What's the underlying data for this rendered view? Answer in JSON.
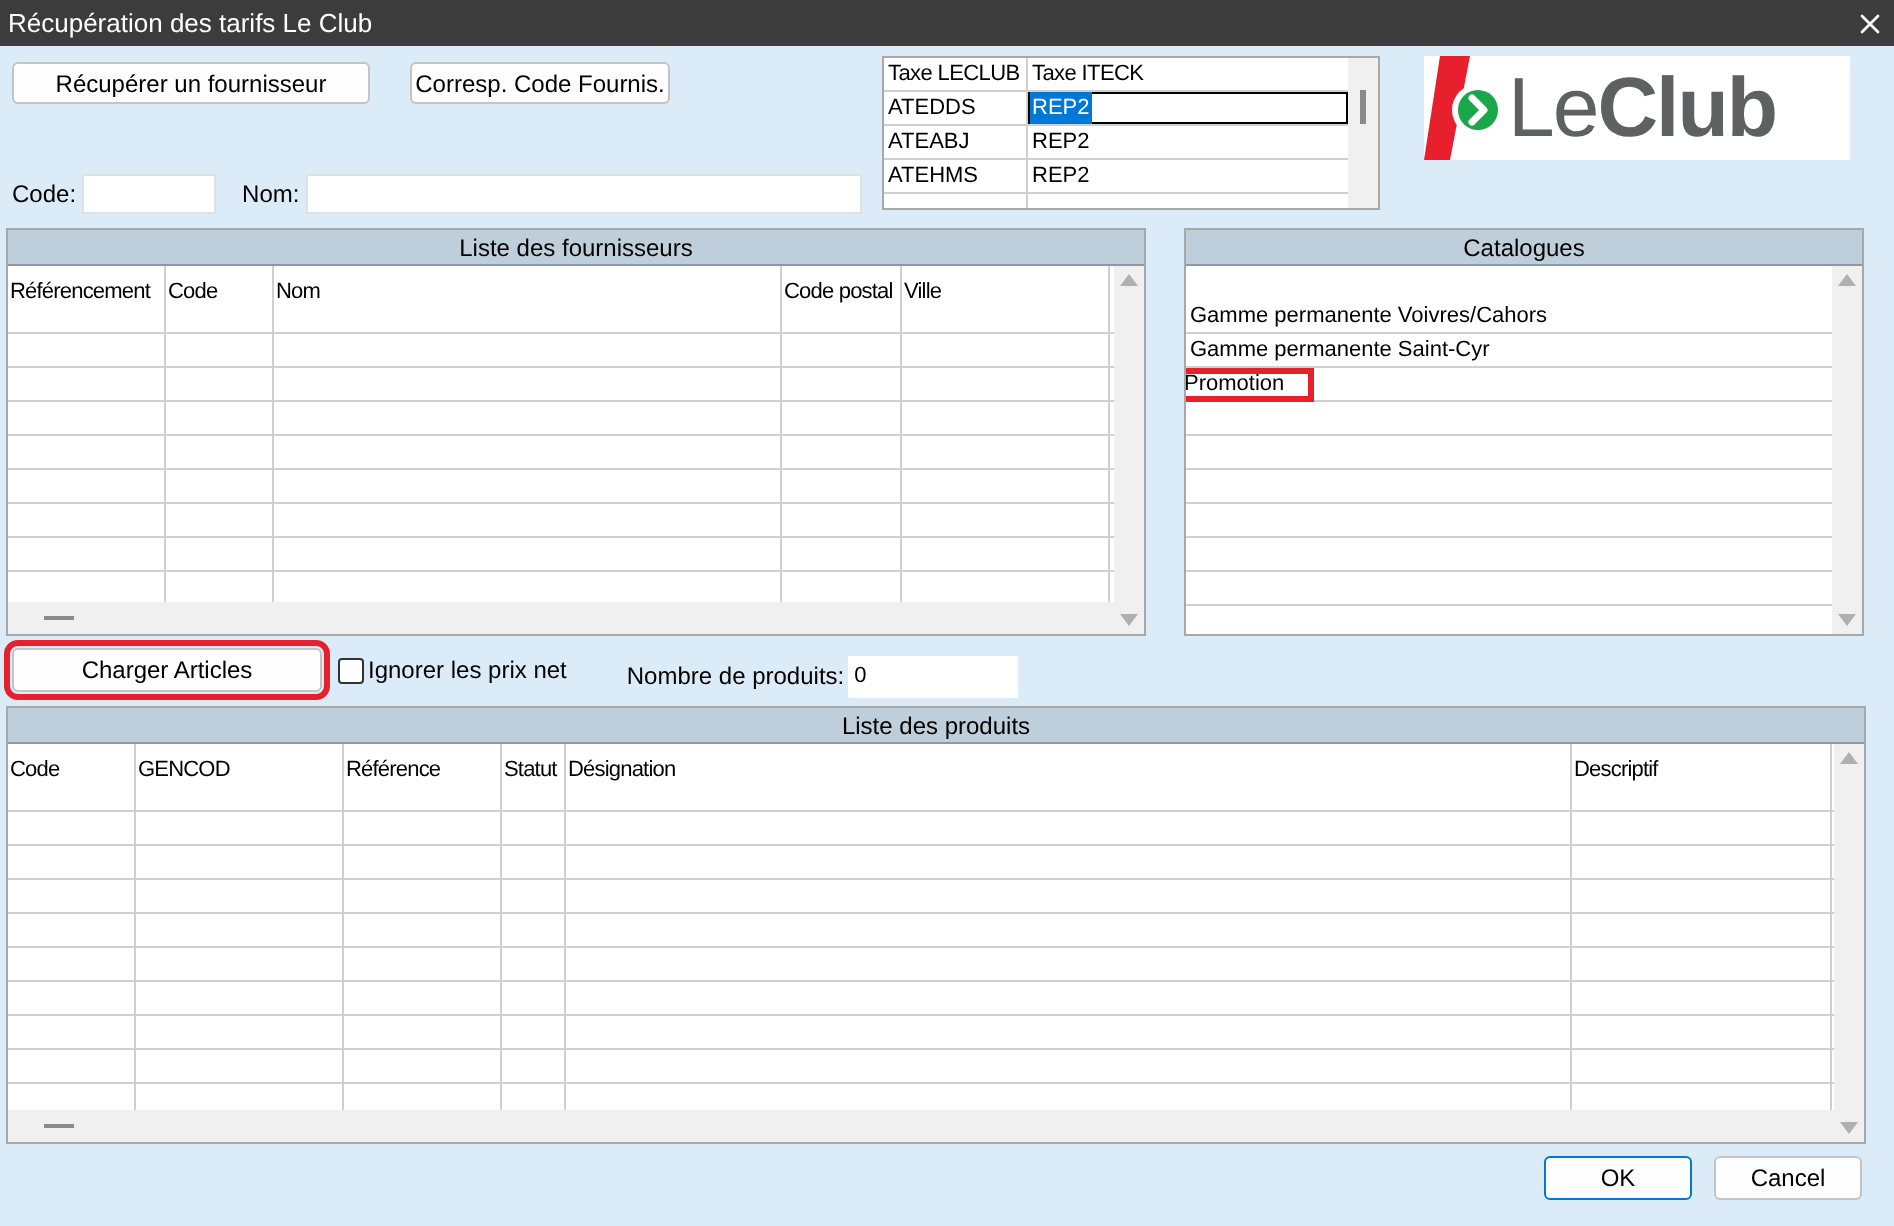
{
  "window": {
    "title": "Récupération des tarifs Le Club"
  },
  "toolbar_buttons": [
    {
      "label": "Récupérer un fournisseur"
    },
    {
      "label": "Corresp. Code Fournis."
    }
  ],
  "filters": [
    {
      "label": "Code:"
    },
    {
      "label": "Nom:"
    }
  ],
  "tax_table": {
    "columns": [
      "Taxe LECLUB",
      "Taxe ITECK"
    ],
    "rows": [
      {
        "cells": [
          "ATEDDS",
          "REP2"
        ],
        "selected": true
      },
      {
        "cells": [
          "ATEABJ",
          "REP2"
        ],
        "selected": false
      },
      {
        "cells": [
          "ATEHMS",
          "REP2"
        ],
        "selected": false
      }
    ]
  },
  "logo": {
    "text": "Le**Club**"
  },
  "suppliers": {
    "title": "Liste des fournisseurs",
    "columns": [
      "Référencement",
      "Code",
      "Nom",
      "Code postal",
      "Ville"
    ]
  },
  "catalogues": {
    "title": "Catalogues",
    "items": [
      {
        "label": "Gamme permanente Voivres/Cahors",
        "highlighted": false
      },
      {
        "label": "Gamme permanente Saint-Cyr",
        "highlighted": false
      },
      {
        "label": "Promotion",
        "highlighted": true
      }
    ]
  },
  "load_button": {
    "label": "Charger Articles",
    "highlighted": true
  },
  "ignore_net_prices": {
    "label": "Ignorer les prix net",
    "checked": false
  },
  "product_count": {
    "label": "Nombre de produits:",
    "value": "0"
  },
  "products": {
    "title": "Liste des produits",
    "columns": [
      "Code",
      "GENCOD",
      "Référence",
      "Statut",
      "Désignation",
      "Descriptif"
    ]
  },
  "dialog_buttons": [
    {
      "label": "OK",
      "default": true
    },
    {
      "label": "Cancel",
      "default": false
    }
  ]
}
